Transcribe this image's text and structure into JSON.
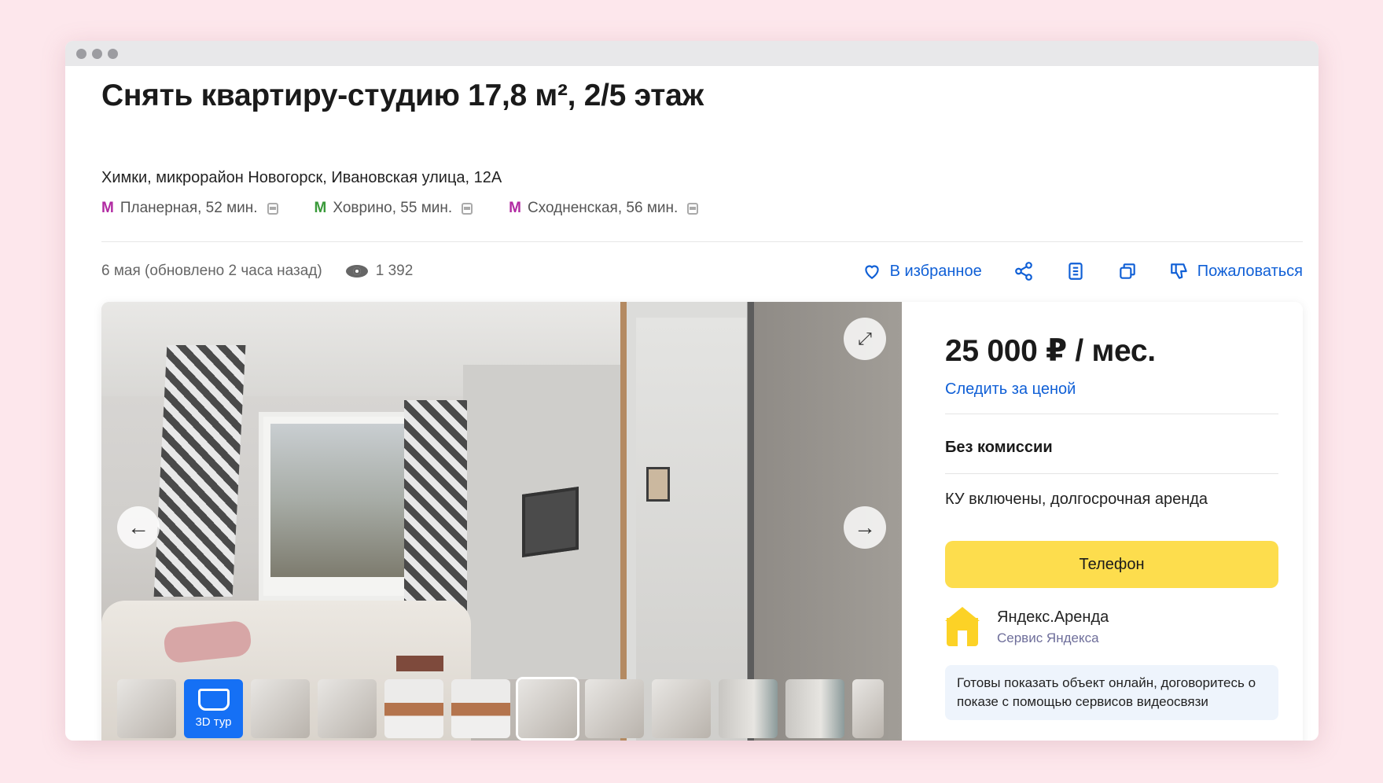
{
  "listing": {
    "title": "Снять квартиру-студию 17,8 м², 2/5 этаж",
    "address": "Химки, микрорайон Новогорск, Ивановская улица, 12А",
    "metro": [
      {
        "symbol": "М",
        "text": "Планерная, 52 мин.",
        "color": "#b12aa2"
      },
      {
        "symbol": "М",
        "text": "Ховрино, 55 мин.",
        "color": "#3a9a3a"
      },
      {
        "symbol": "М",
        "text": "Сходненская, 56 мин.",
        "color": "#b12aa2"
      }
    ],
    "date": "6 мая (обновлено 2 часа назад)",
    "views": "1 392"
  },
  "actions": {
    "favorite": "В избранное",
    "complain": "Пожаловаться"
  },
  "gallery": {
    "tour_label": "3D тур"
  },
  "offer": {
    "price": "25 000 ₽ / мес.",
    "watch_price": "Следить за ценой",
    "condition1": "Без комиссии",
    "condition2": "КУ включены, долгосрочная аренда",
    "phone_button": "Телефон",
    "agent_name": "Яндекс.Аренда",
    "agent_sub": "Сервис Яндекса",
    "notice": "Готовы показать объект онлайн, договоритесь о показе с помощью сервисов видеосвязи"
  },
  "colors": {
    "accent_link": "#0f5fd6",
    "phone_button": "#fddd4d",
    "tour_tile": "#1570f5",
    "background": "#fde7ec"
  }
}
